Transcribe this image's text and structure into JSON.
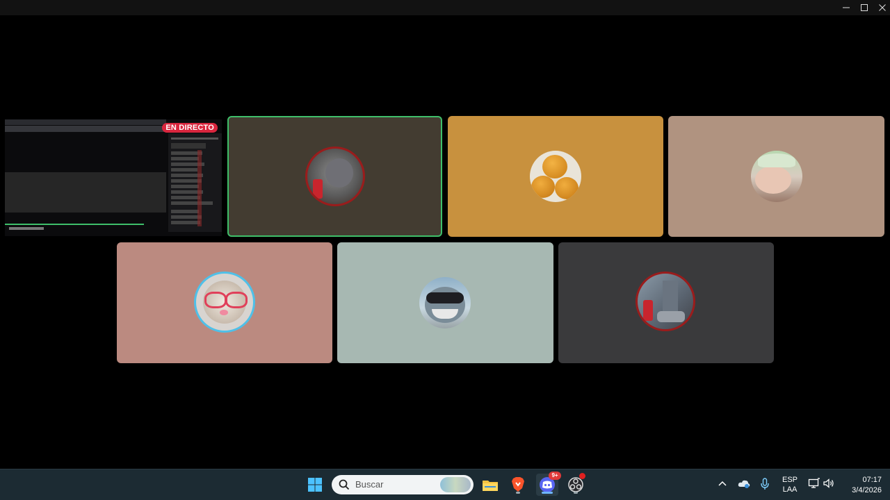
{
  "window": {
    "buttons": {
      "minimize": "minimize-icon",
      "maximize": "maximize-icon",
      "close": "close-icon"
    }
  },
  "stream_tile": {
    "badge": "EN DIRECTO",
    "badge_color": "#d9263e"
  },
  "tiles": [
    {
      "id": "participant-1",
      "bg": "#433c31",
      "speaking": true,
      "avatar": "mouse-cartoon-avatar"
    },
    {
      "id": "participant-2",
      "bg": "#c8913e",
      "speaking": false,
      "avatar": "orange-balls-avatar"
    },
    {
      "id": "participant-3",
      "bg": "#b09380",
      "speaking": false,
      "avatar": "person-cap-avatar"
    },
    {
      "id": "participant-4",
      "bg": "#bb8a80",
      "speaking": false,
      "avatar": "cat-glasses-avatar"
    },
    {
      "id": "participant-5",
      "bg": "#a7b8b2",
      "speaking": false,
      "avatar": "shark-goggles-avatar"
    },
    {
      "id": "participant-6",
      "bg": "#3a3a3c",
      "speaking": false,
      "avatar": "building-avatar"
    }
  ],
  "taskbar": {
    "search_placeholder": "Buscar",
    "discord_badge": "9+",
    "icons": [
      "windows-start-icon",
      "search-icon",
      "file-explorer-icon",
      "brave-browser-icon",
      "discord-icon",
      "obs-icon"
    ],
    "tray": {
      "language_line1": "ESP",
      "language_line2": "LAA",
      "time": "07:17",
      "date": "3/4/2026"
    }
  },
  "colors": {
    "speaking_border": "#3fbf6a",
    "taskbar_bg": "#1c2b33",
    "accent": "#5865f2"
  }
}
